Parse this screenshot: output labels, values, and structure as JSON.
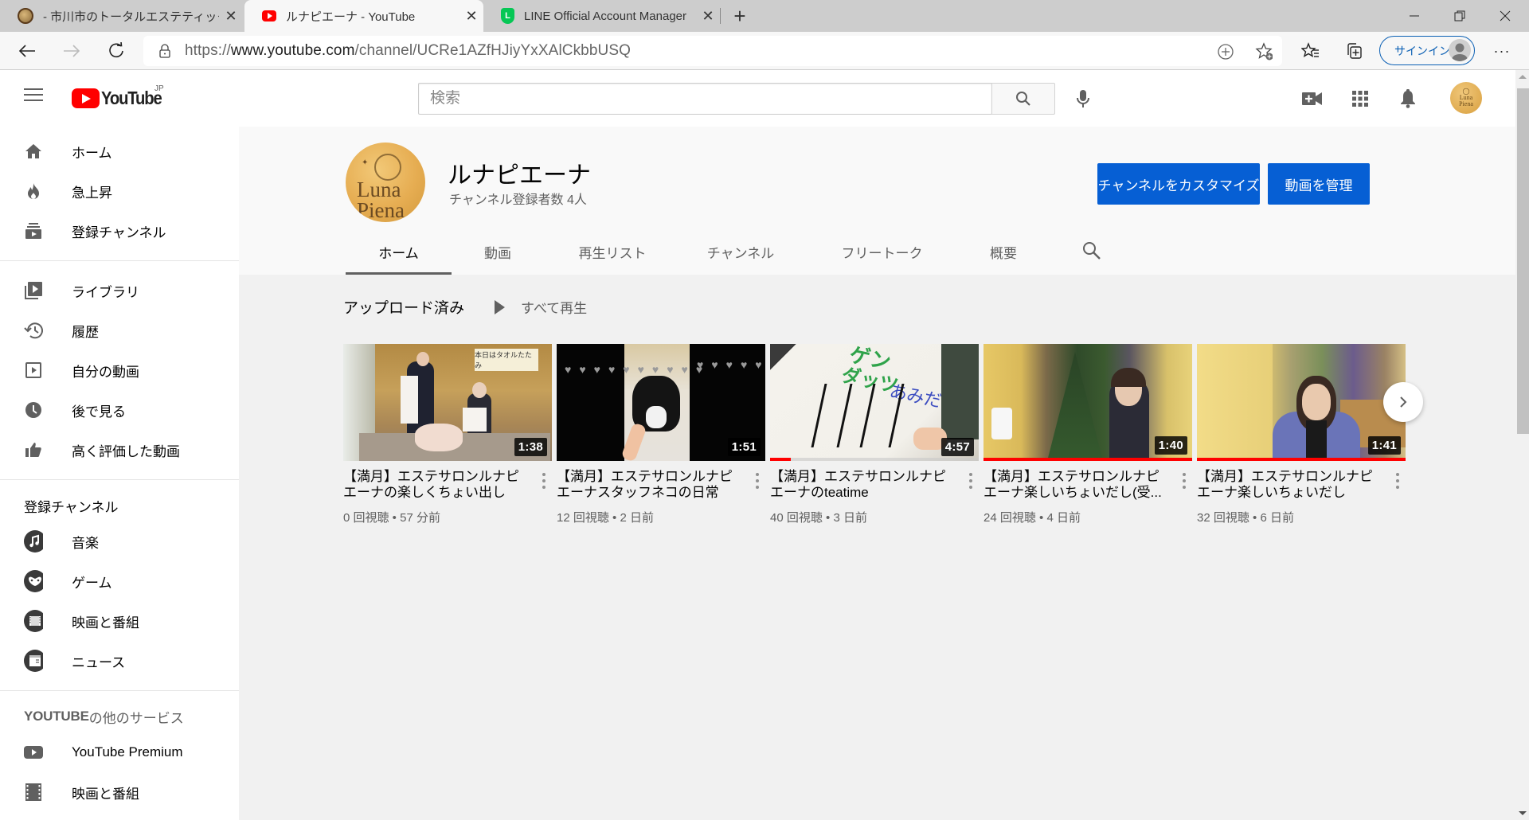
{
  "browser": {
    "tabs": [
      {
        "title": "- 市川市のトータルエステティックサロン",
        "favicon": "luna-piena-favicon",
        "active": false
      },
      {
        "title": "ルナピエーナ - YouTube",
        "favicon": "youtube-favicon",
        "active": true
      },
      {
        "title": "LINE Official Account Manager",
        "favicon": "line-favicon",
        "active": false
      }
    ],
    "new_tab_label": "+",
    "url_host_prefix": "https://",
    "url_host": "www.youtube.com",
    "url_path": "/channel/UCRe1AZfHJiyYxXAlCkbbUSQ",
    "signin_label": "サインイン",
    "more_label": "···"
  },
  "youtube_header": {
    "logo_text": "YouTube",
    "region": "JP",
    "search_placeholder": "検索"
  },
  "sidebar": {
    "main_items": [
      {
        "label": "ホーム",
        "icon": "home-icon"
      },
      {
        "label": "急上昇",
        "icon": "trending-icon"
      },
      {
        "label": "登録チャンネル",
        "icon": "subscriptions-icon"
      }
    ],
    "library_items": [
      {
        "label": "ライブラリ",
        "icon": "library-icon"
      },
      {
        "label": "履歴",
        "icon": "history-icon"
      },
      {
        "label": "自分の動画",
        "icon": "your-videos-icon"
      },
      {
        "label": "後で見る",
        "icon": "watch-later-icon"
      },
      {
        "label": "高く評価した動画",
        "icon": "liked-videos-icon"
      }
    ],
    "subscriptions_heading": "登録チャンネル",
    "subscriptions": [
      {
        "label": "音楽",
        "icon": "music-icon"
      },
      {
        "label": "ゲーム",
        "icon": "gaming-icon"
      },
      {
        "label": "映画と番組",
        "icon": "movies-icon"
      },
      {
        "label": "ニュース",
        "icon": "news-icon"
      }
    ],
    "more_heading_bold": "YOUTUBE",
    "more_heading_rest": " の他のサービス",
    "more_services": [
      {
        "label": "YouTube Premium",
        "icon": "youtube-premium-icon"
      },
      {
        "label": "映画と番組",
        "icon": "film-icon"
      }
    ]
  },
  "channel": {
    "name": "ルナピエーナ",
    "subscribers": "チャンネル登録者数 4人",
    "avatar_text": "Luna Piena",
    "customize_button": "チャンネルをカスタマイズ",
    "manage_button": "動画を管理",
    "tabs": [
      {
        "label": "ホーム",
        "active": true
      },
      {
        "label": "動画",
        "active": false
      },
      {
        "label": "再生リスト",
        "active": false
      },
      {
        "label": "チャンネル",
        "active": false
      },
      {
        "label": "フリートーク",
        "active": false
      },
      {
        "label": "概要",
        "active": false
      }
    ]
  },
  "uploads": {
    "title": "アップロード済み",
    "play_all": "すべて再生",
    "videos": [
      {
        "title": "【満月】エステサロンルナピエーナの楽しくちょい出し",
        "duration": "1:38",
        "views": "0 回視聴",
        "age": "57 分前",
        "watched_fraction": 0
      },
      {
        "title": "【満月】エステサロンルナピエーナスタッフネコの日常",
        "duration": "1:51",
        "views": "12 回視聴",
        "age": "2 日前",
        "watched_fraction": 0
      },
      {
        "title": "【満月】エステサロンルナピエーナのteatime",
        "duration": "4:57",
        "views": "40 回視聴",
        "age": "3 日前",
        "watched_fraction": 0.1
      },
      {
        "title": "【満月】エステサロンルナピエーナ楽しいちょいだし(受...",
        "duration": "1:40",
        "views": "24 回視聴",
        "age": "4 日前",
        "watched_fraction": 1.0
      },
      {
        "title": "【満月】エステサロンルナピエーナ楽しいちょいだし",
        "duration": "1:41",
        "views": "32 回視聴",
        "age": "6 日前",
        "watched_fraction": 1.0
      }
    ],
    "meta_separator": " • "
  }
}
